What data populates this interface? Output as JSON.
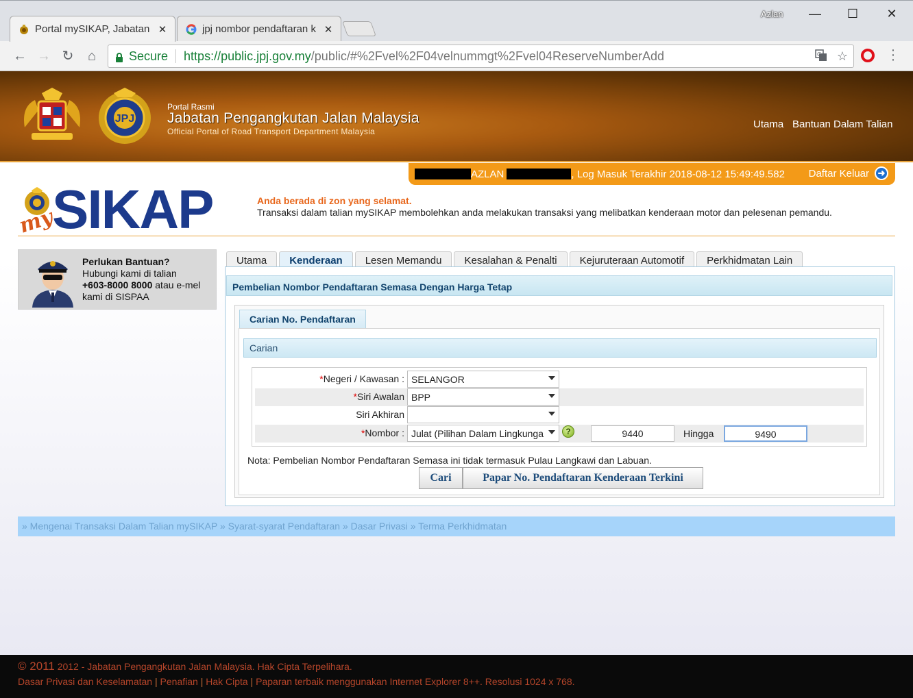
{
  "browser": {
    "tabs": [
      {
        "title": "Portal mySIKAP, Jabatan P",
        "close": "✕",
        "active": true
      },
      {
        "title": "jpj nombor pendaftaran k",
        "close": "✕",
        "active": false
      }
    ],
    "profile_name": "Azlan",
    "secure_label": "Secure",
    "url_host": "https://public.jpj.gov.my",
    "url_path": "/public/#%2Fvel%2F04velnummgt%2Fvel04ReserveNumberAdd"
  },
  "banner": {
    "small": "Portal Rasmi",
    "title": "Jabatan Pengangkutan Jalan Malaysia",
    "subtitle": "Official Portal of Road Transport Department Malaysia",
    "nav": [
      "Utama",
      "Bantuan Dalam Talian"
    ]
  },
  "userbar": {
    "name": "AZLAN",
    "last_login": ", Log Masuk Terakhir 2018-08-12 15:49:49.582",
    "logout_label": "Daftar Keluar"
  },
  "logo": {
    "my": "my",
    "main": "SIKAP"
  },
  "notice": {
    "title": "Anda berada di zon yang selamat.",
    "desc": "Transaksi dalam talian mySIKAP membolehkan anda melakukan transaksi yang melibatkan kenderaan motor dan pelesenan pemandu."
  },
  "help": {
    "title": "Perlukan Bantuan?",
    "line1": "Hubungi kami di talian",
    "phone": "+603-8000 8000",
    "line2_rest": " atau e-mel",
    "line3": "kami di SISPAA"
  },
  "tabs": [
    {
      "label": "Utama",
      "active": false
    },
    {
      "label": "Kenderaan",
      "active": true
    },
    {
      "label": "Lesen Memandu",
      "active": false
    },
    {
      "label": "Kesalahan & Penalti",
      "active": false
    },
    {
      "label": "Kejuruteraan Automotif",
      "active": false
    },
    {
      "label": "Perkhidmatan Lain",
      "active": false
    }
  ],
  "panel": {
    "heading": "Pembelian Nombor Pendaftaran Semasa Dengan Harga Tetap",
    "subtab": "Carian No. Pendaftaran",
    "section": "Carian"
  },
  "form": {
    "negeri": {
      "label": "Negeri / Kawasan :",
      "value": "SELANGOR"
    },
    "siri_awalan": {
      "label": "Siri Awalan",
      "value": "BPP"
    },
    "siri_akhiran": {
      "label": "Siri Akhiran",
      "value": ""
    },
    "nombor": {
      "label": "Nombor :",
      "value": "Julat (Pilihan Dalam Lingkungan)",
      "from": "9440",
      "to_label": "Hingga",
      "to": "9490",
      "help": "?"
    },
    "required_mark": "*"
  },
  "note": "Nota: Pembelian Nombor Pendaftaran Semasa ini tidak termasuk Pulau Langkawi dan Labuan.",
  "buttons": {
    "search": "Cari",
    "latest": "Papar No. Pendaftaran Kenderaan Terkini"
  },
  "footer_links": "» Mengenai Transaksi Dalam Talian mySIKAP » Syarat-syarat Pendaftaran » Dasar Privasi » Terma Perkhidmatan",
  "footer": {
    "year": "© 2011",
    "copyright_rest": " 2012 - Jabatan Pengangkutan Jalan Malaysia. Hak Cipta Terpelihara.",
    "links": [
      "Dasar Privasi dan Keselamatan",
      "Penafian",
      "Hak Cipta"
    ],
    "best_viewed": "Paparan terbaik menggunakan Internet Explorer 8++. Resolusi 1024 x 768."
  },
  "colors": {
    "banner": "#a85a10",
    "accent_orange": "#f39a18",
    "link_bar": "#a6d4fa",
    "logo_blue": "#1c3a8c"
  }
}
